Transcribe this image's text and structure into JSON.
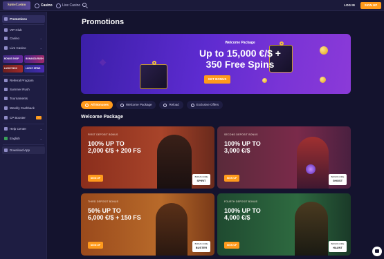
{
  "header": {
    "logo_text": "SpinsCasino",
    "nav": [
      {
        "label": "Casino",
        "active": true
      },
      {
        "label": "Live Casino",
        "active": false
      }
    ],
    "login_label": "LOG IN",
    "signup_label": "SIGN UP"
  },
  "sidebar": {
    "items": [
      {
        "label": "Promotions",
        "active": true
      },
      {
        "label": "VIP Club"
      },
      {
        "label": "Casino"
      },
      {
        "label": "Live Casino"
      },
      {
        "label": "Referral Program"
      },
      {
        "label": "Summer Rush"
      },
      {
        "label": "Tournaments"
      },
      {
        "label": "Weekly Cashback"
      },
      {
        "label": "CP Booster"
      },
      {
        "label": "Help Center"
      },
      {
        "label": "English"
      },
      {
        "label": "Download App"
      }
    ],
    "promo_tiles": [
      "BONUS SHOP",
      "BONANZA RUSH",
      "LUCKY BOX",
      "LUCKY SPINS"
    ]
  },
  "main": {
    "title": "Promotions",
    "hero": {
      "subtitle": "Welcome Package",
      "headline_line1": "Up to 15,000 €/$ +",
      "headline_line2": "350 Free Spins",
      "cta": "GET BONUS"
    },
    "filters": [
      "All Bonuses",
      "Welcome Package",
      "Reload",
      "Exclusive Offers"
    ],
    "section_title": "Welcome Package",
    "cards": [
      {
        "label": "FIRST DEPOSIT BONUS",
        "line1": "100% UP TO",
        "line2": "2,000 €/$ + 200 FS",
        "button": "SIGN UP",
        "code_title": "BONUS CODE",
        "code": "SPIRIT",
        "bg": "#8a2e1c"
      },
      {
        "label": "SECOND DEPOSIT BONUS",
        "line1": "100% UP TO",
        "line2": "3,000 €/$",
        "button": "SIGN UP",
        "code_title": "BONUS CODE",
        "code": "GHOST",
        "bg": "#6e2a4e"
      },
      {
        "label": "THIRD DEPOSIT BONUS",
        "line1": "50% UP TO",
        "line2": "6,000 €/$ + 150 FS",
        "button": "SIGN UP",
        "code_title": "BONUS CODE",
        "code": "BUSTER",
        "bg": "#9a4a1c"
      },
      {
        "label": "FOURTH DEPOSIT BONUS",
        "line1": "100% UP TO",
        "line2": "4,000 €/$",
        "button": "SIGN UP",
        "code_title": "BONUS CODE",
        "code": "HAUNT",
        "bg": "#2a5a3a"
      }
    ]
  },
  "colors": {
    "accent": "#ff9a1c",
    "background": "#14132e",
    "sidebar": "#1e1d42"
  }
}
